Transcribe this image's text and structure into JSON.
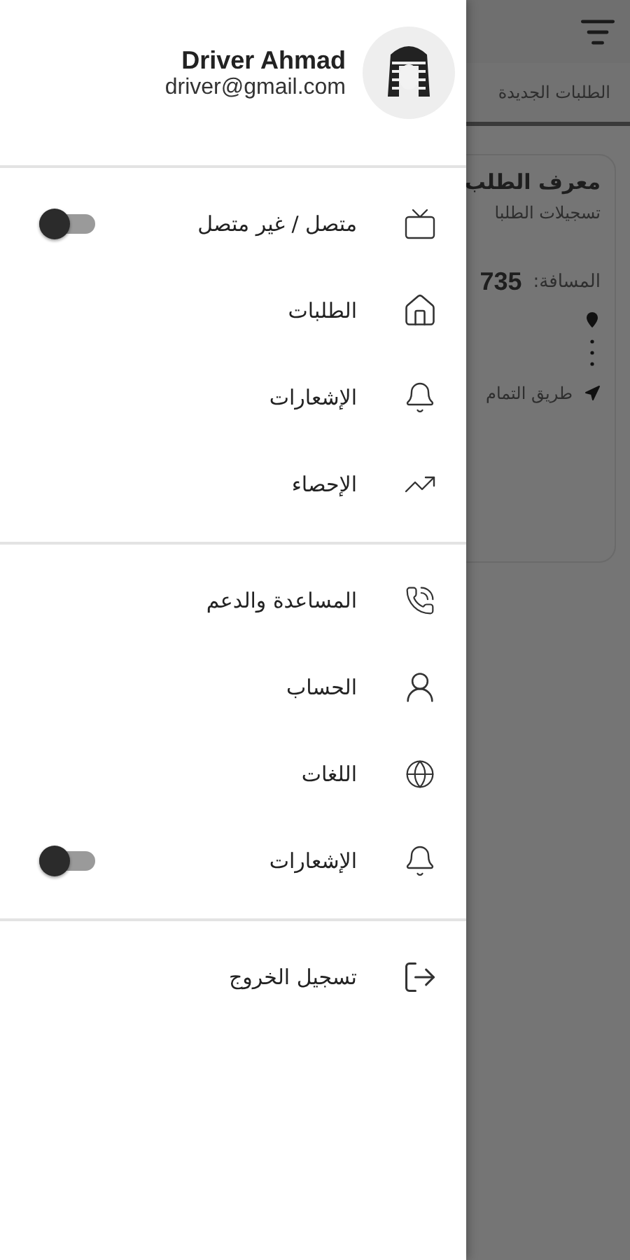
{
  "drawer": {
    "name": "Driver Ahmad",
    "email": "driver@gmail.com",
    "sections": [
      {
        "items": [
          {
            "kind": "toggle",
            "label": "متصل / غير متصل",
            "on": false
          },
          {
            "kind": "link",
            "label": "الطلبات"
          },
          {
            "kind": "link",
            "label": "الإشعارات"
          },
          {
            "kind": "link",
            "label": "الإحصاء"
          }
        ]
      },
      {
        "items": [
          {
            "kind": "link",
            "label": "المساعدة والدعم"
          },
          {
            "kind": "link",
            "label": "الحساب"
          },
          {
            "kind": "link",
            "label": "اللغات"
          },
          {
            "kind": "toggle",
            "label": "الإشعارات",
            "on": false
          }
        ]
      },
      {
        "items": [
          {
            "kind": "link",
            "label": "تسجيل الخروج"
          }
        ]
      }
    ]
  },
  "background": {
    "tab": "الطلبات الجديدة",
    "card": {
      "title": "معرف الطلب",
      "subtitle": "تسجيلات الطلبا",
      "distance_label": "المسافة:",
      "distance": "735",
      "route": "طريق التمام"
    }
  }
}
